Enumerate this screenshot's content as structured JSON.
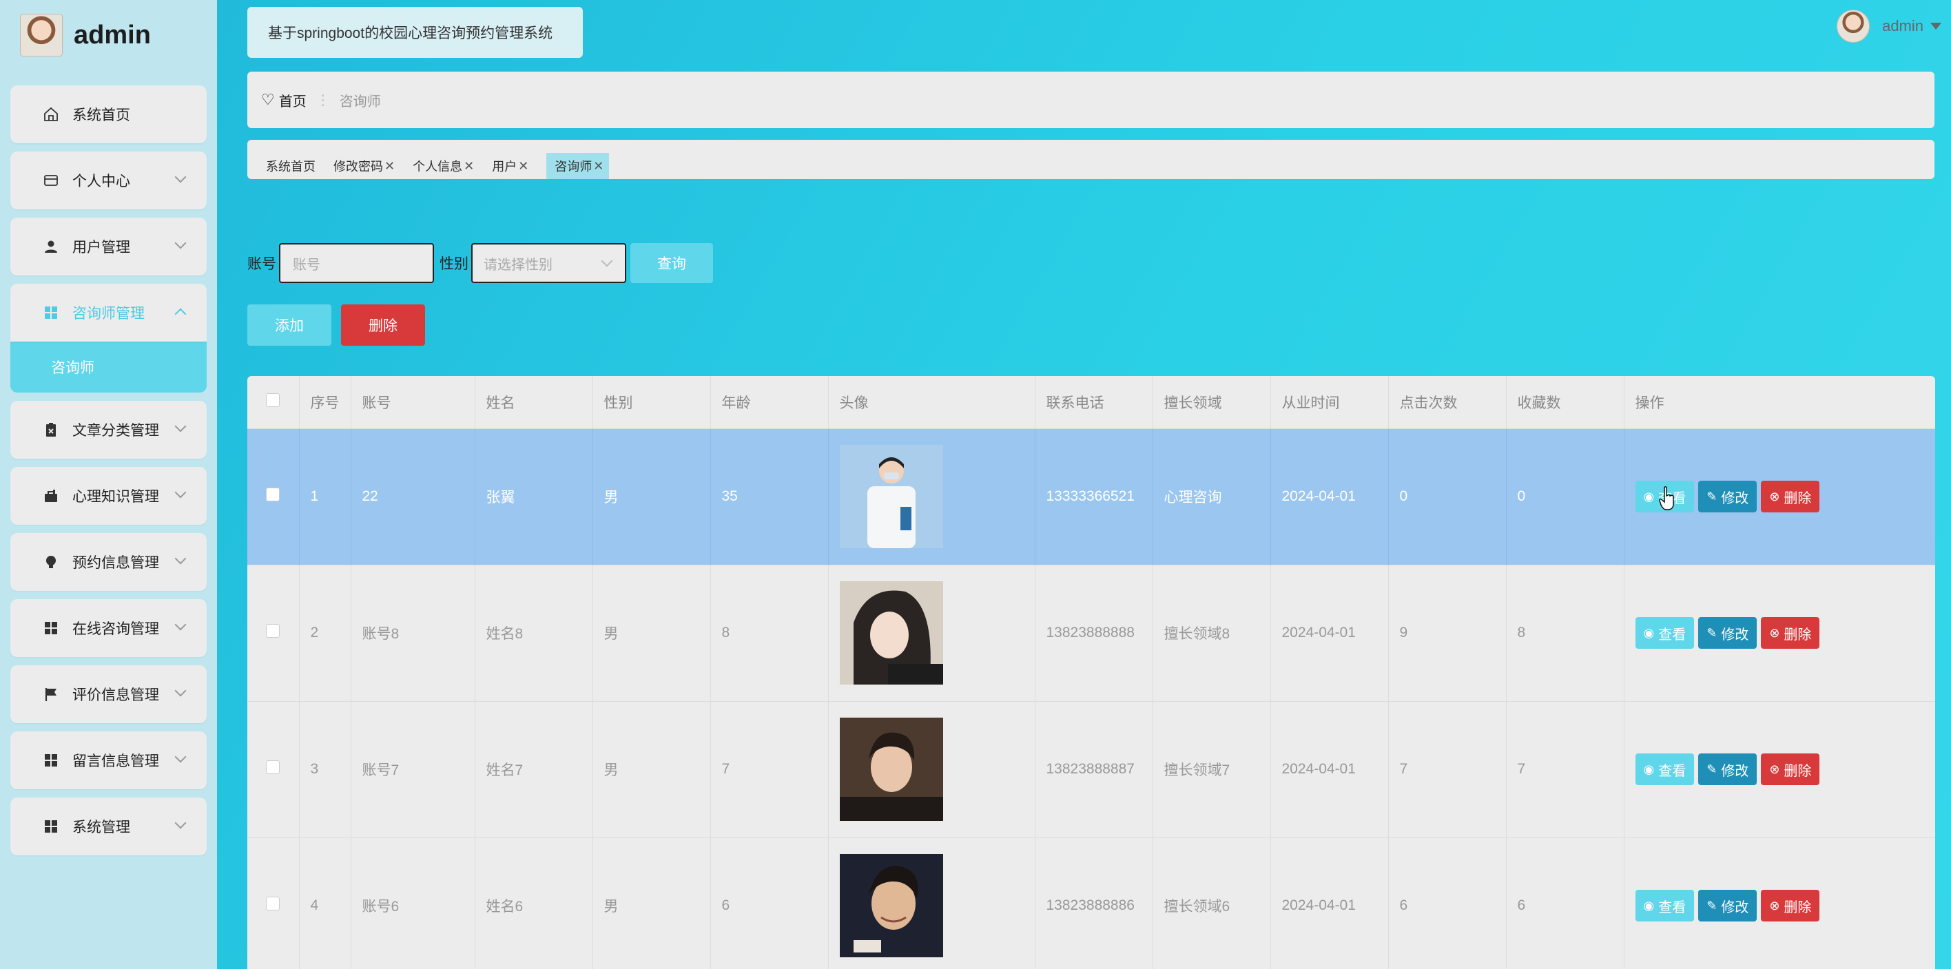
{
  "sidebar": {
    "username": "admin",
    "items": [
      {
        "label": "系统首页",
        "icon": "home-icon",
        "expandable": false
      },
      {
        "label": "个人中心",
        "icon": "card-icon",
        "expandable": true
      },
      {
        "label": "用户管理",
        "icon": "user-icon",
        "expandable": true
      },
      {
        "label": "咨询师管理",
        "icon": "grid-icon",
        "expandable": true,
        "open": true,
        "sub": "咨询师"
      },
      {
        "label": "文章分类管理",
        "icon": "clipboard-icon",
        "expandable": true
      },
      {
        "label": "心理知识管理",
        "icon": "briefcase-icon",
        "expandable": true
      },
      {
        "label": "预约信息管理",
        "icon": "bulb-icon",
        "expandable": true
      },
      {
        "label": "在线咨询管理",
        "icon": "grid-icon",
        "expandable": true
      },
      {
        "label": "评价信息管理",
        "icon": "flag-icon",
        "expandable": true
      },
      {
        "label": "留言信息管理",
        "icon": "grid-icon",
        "expandable": true
      },
      {
        "label": "系统管理",
        "icon": "grid-icon",
        "expandable": true
      }
    ]
  },
  "header": {
    "system_title": "基于springboot的校园心理咨询预约管理系统",
    "user": "admin"
  },
  "breadcrumb": {
    "home": "首页",
    "current": "咨询师"
  },
  "tags": [
    {
      "label": "系统首页",
      "closable": false
    },
    {
      "label": "修改密码",
      "closable": true
    },
    {
      "label": "个人信息",
      "closable": true
    },
    {
      "label": "用户",
      "closable": true
    },
    {
      "label": "咨询师",
      "closable": true,
      "active": true
    }
  ],
  "search": {
    "account_label": "账号",
    "account_placeholder": "账号",
    "gender_label": "性别",
    "gender_placeholder": "请选择性别",
    "query_button": "查询"
  },
  "actions": {
    "add": "添加",
    "delete": "删除"
  },
  "table": {
    "headers": [
      "序号",
      "账号",
      "姓名",
      "性别",
      "年龄",
      "头像",
      "联系电话",
      "擅长领域",
      "从业时间",
      "点击次数",
      "收藏数",
      "操作"
    ],
    "row_buttons": {
      "view": "查看",
      "edit": "修改",
      "delete": "删除"
    },
    "rows": [
      {
        "index": "1",
        "account": "22",
        "name": "张翼",
        "gender": "男",
        "age": "35",
        "photo": "doctor-photo",
        "phone": "13333366521",
        "field": "心理咨询",
        "since": "2024-04-01",
        "clicks": "0",
        "favorites": "0",
        "selected": true
      },
      {
        "index": "2",
        "account": "账号8",
        "name": "姓名8",
        "gender": "男",
        "age": "8",
        "photo": "portrait-girl-photo",
        "phone": "13823888888",
        "field": "擅长领域8",
        "since": "2024-04-01",
        "clicks": "9",
        "favorites": "8"
      },
      {
        "index": "3",
        "account": "账号7",
        "name": "姓名7",
        "gender": "男",
        "age": "7",
        "photo": "portrait-man-photo",
        "phone": "13823888887",
        "field": "擅长领域7",
        "since": "2024-04-01",
        "clicks": "7",
        "favorites": "7"
      },
      {
        "index": "4",
        "account": "账号6",
        "name": "姓名6",
        "gender": "男",
        "age": "6",
        "photo": "portrait-boy-photo",
        "phone": "13823888886",
        "field": "擅长领域6",
        "since": "2024-04-01",
        "clicks": "6",
        "favorites": "6"
      }
    ]
  },
  "colors": {
    "accent": "#5fd6ea",
    "danger": "#d8393a",
    "edit": "#1f8fb8",
    "selected_row": "#9bc6ef"
  }
}
